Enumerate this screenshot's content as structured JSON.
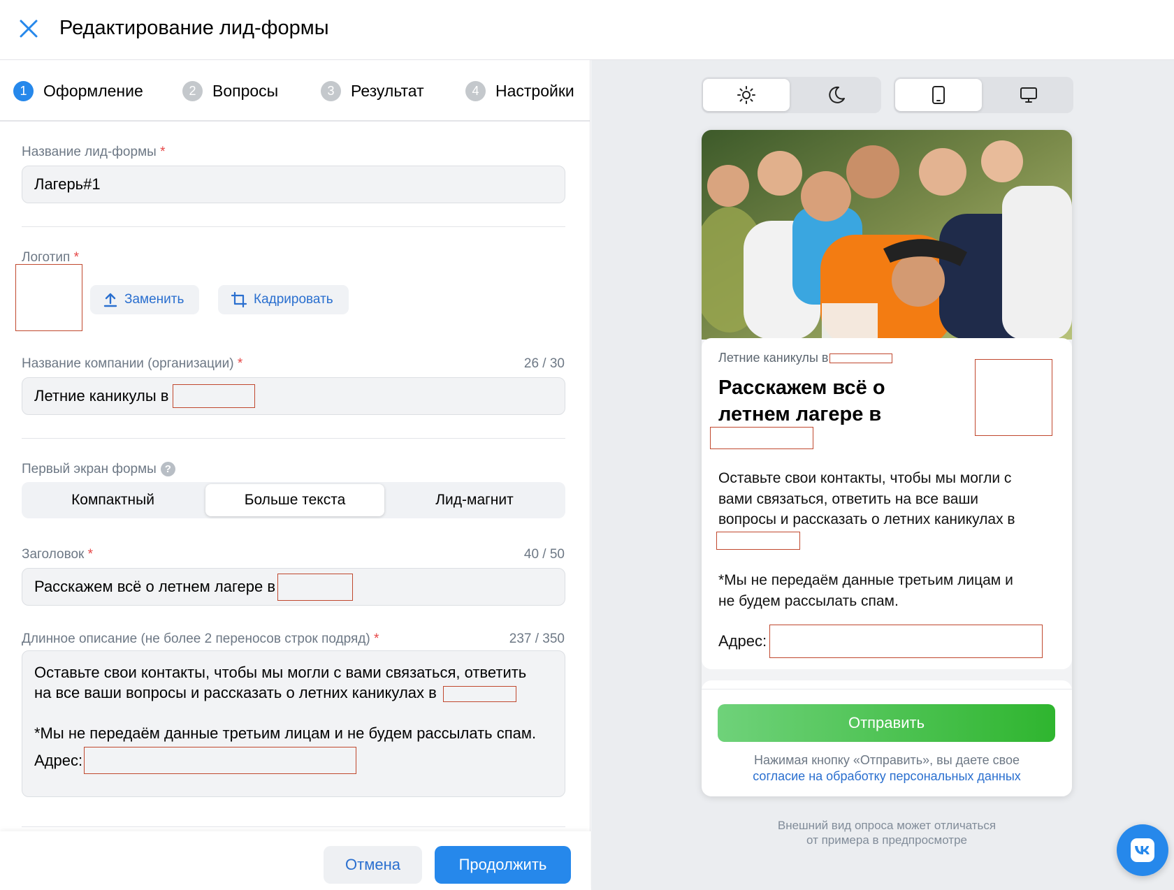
{
  "header": {
    "title": "Редактирование лид-формы",
    "close_icon": "close-icon"
  },
  "steps": [
    {
      "num": "1",
      "label": "Оформление",
      "active": true
    },
    {
      "num": "2",
      "label": "Вопросы",
      "active": false
    },
    {
      "num": "3",
      "label": "Результат",
      "active": false
    },
    {
      "num": "4",
      "label": "Настройки",
      "active": false
    }
  ],
  "form": {
    "name": {
      "label": "Название лид-формы",
      "required_mark": "*",
      "value": "Лагерь#1"
    },
    "logo": {
      "label": "Логотип",
      "required_mark": "*",
      "replace_label": "Заменить",
      "crop_label": "Кадрировать"
    },
    "company": {
      "label": "Название компании (организации)",
      "required_mark": "*",
      "counter": "26 / 30",
      "value": "Летние каникулы в"
    },
    "first_screen": {
      "label": "Первый экран формы",
      "help": "?",
      "options": [
        "Компактный",
        "Больше текста",
        "Лид-магнит"
      ],
      "selected": "Больше текста"
    },
    "heading": {
      "label": "Заголовок",
      "required_mark": "*",
      "counter": "40 / 50",
      "value": "Расскажем всё о летнем лагере в"
    },
    "description": {
      "label": "Длинное описание (не более 2 переносов строк подряд)",
      "required_mark": "*",
      "counter": "237 / 350",
      "line1": "Оставьте свои контакты, чтобы мы могли с вами связаться, ответить",
      "line2": "на все ваши вопросы и рассказать о летних каникулах в",
      "line3": "*Мы не передаём данные третьим лицам и не будем рассылать спам.",
      "line4": "Адрес:"
    }
  },
  "footer": {
    "cancel_label": "Отмена",
    "continue_label": "Продолжить"
  },
  "preview": {
    "theme_toggle": {
      "light_icon": "sun-icon",
      "dark_icon": "moon-icon",
      "selected": "light"
    },
    "device_toggle": {
      "mobile_icon": "phone-icon",
      "desktop_icon": "monitor-icon",
      "selected": "mobile"
    },
    "company": "Летние каникулы в",
    "title": "Расскажем всё о летнем лагере в",
    "desc_line1": "Оставьте свои контакты, чтобы мы могли с",
    "desc_line2": "вами связаться, ответить на все ваши",
    "desc_line3": "вопросы и рассказать о летних каникулах в",
    "note_line1": "*Мы не передаём данные третьим лицам и",
    "note_line2": "не будем рассылать спам.",
    "address_label": "Адрес:",
    "send_label": "Отправить",
    "consent_text": "Нажимая кнопку «Отправить», вы даете свое",
    "consent_link": "согласие на обработку персональных данных",
    "note_bottom_1": "Внешний вид опроса может отличаться",
    "note_bottom_2": "от примера в предпросмотре"
  },
  "vk_button": {
    "icon": "vk-logo-icon"
  }
}
